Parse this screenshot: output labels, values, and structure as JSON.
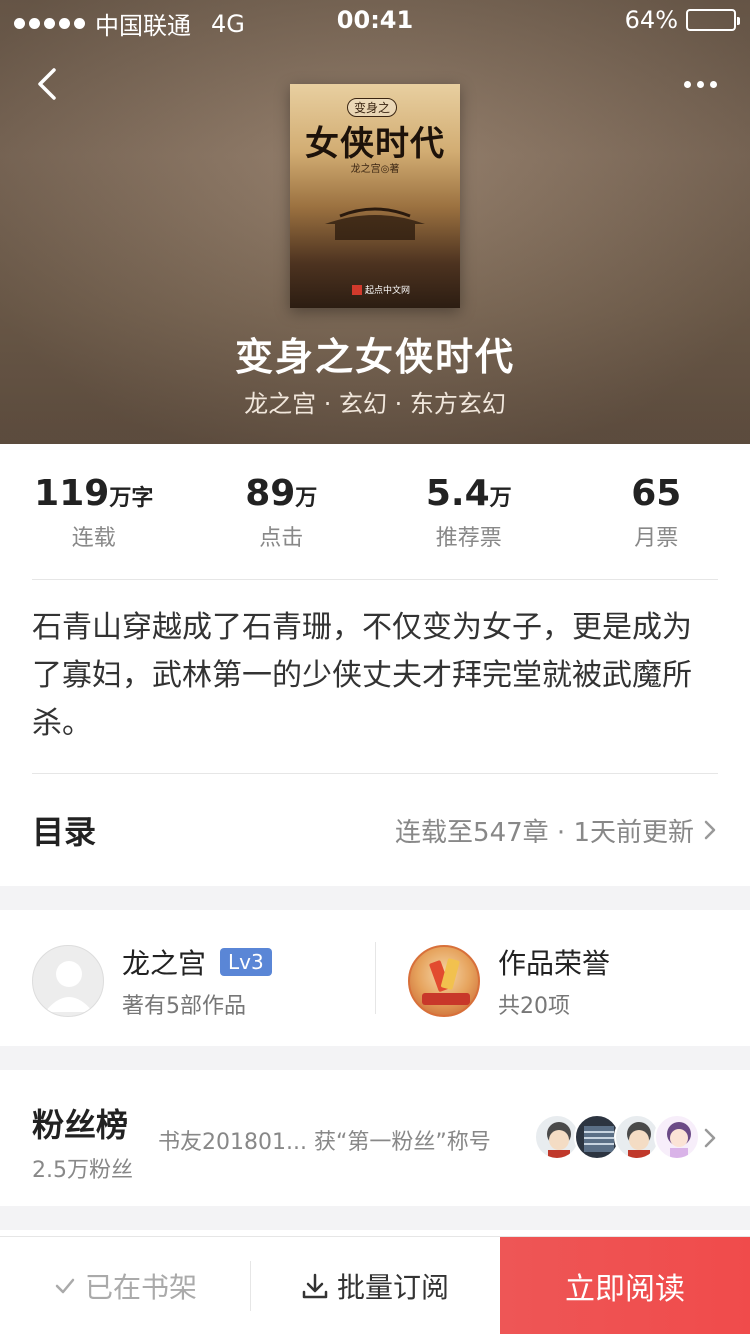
{
  "status_bar": {
    "carrier": "中国联通",
    "network": "4G",
    "time": "00:41",
    "battery": "64%",
    "battery_level": 0.64
  },
  "book": {
    "cover_badge": "变身之",
    "cover_title": "女侠时代",
    "cover_author": "龙之宫◎著",
    "cover_publisher": "起点中文网",
    "title": "变身之女侠时代",
    "meta": "龙之宫 · 玄幻 · 东方玄幻"
  },
  "stats": [
    {
      "value": "119",
      "unit": "万字",
      "label": "连载"
    },
    {
      "value": "89",
      "unit": "万",
      "label": "点击"
    },
    {
      "value": "5.4",
      "unit": "万",
      "label": "推荐票"
    },
    {
      "value": "65",
      "unit": "",
      "label": "月票"
    }
  ],
  "summary": "石青山穿越成了石青珊，不仅变为女子，更是成为了寡妇，武林第一的少侠丈夫才拜完堂就被武魔所杀。",
  "catalog": {
    "title": "目录",
    "info": "连载至547章 · 1天前更新"
  },
  "author": {
    "name": "龙之宫",
    "level": "Lv3",
    "works": "著有5部作品"
  },
  "honor": {
    "title": "作品荣誉",
    "count": "共20项",
    "icon_label": "更上一层楼"
  },
  "fans": {
    "title": "粉丝榜",
    "count": "2.5万粉丝",
    "message": "书友201801...  获“第一粉丝”称号"
  },
  "bottom_bar": {
    "shelf": "已在书架",
    "subscribe": "批量订阅",
    "read": "立即阅读"
  }
}
